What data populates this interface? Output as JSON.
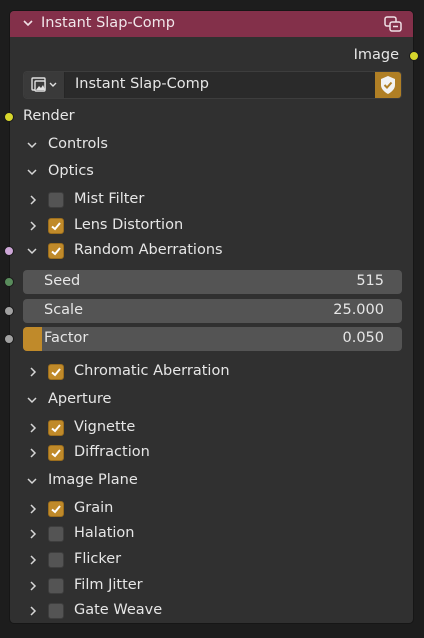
{
  "node": {
    "title": "Instant Slap-Comp",
    "output_label": "Image",
    "datablock_name": "Instant Slap-Comp",
    "render_input_label": "Render",
    "colors": {
      "header": "#83304a",
      "accent": "#c08a2a",
      "socket_color": "#d6d62c",
      "socket_bool": "#cca6d6",
      "socket_int": "#598c5c",
      "socket_float": "#a1a1a1"
    }
  },
  "panels": {
    "controls": "Controls",
    "optics": "Optics",
    "mist_filter": "Mist Filter",
    "lens_distortion": "Lens Distortion",
    "random_aberrations": "Random Aberrations",
    "chromatic_aberration": "Chromatic Aberration",
    "aperture": "Aperture",
    "vignette": "Vignette",
    "diffraction": "Diffraction",
    "image_plane": "Image Plane",
    "grain": "Grain",
    "halation": "Halation",
    "flicker": "Flicker",
    "film_jitter": "Film Jitter",
    "gate_weave": "Gate Weave"
  },
  "checked": {
    "mist_filter": false,
    "lens_distortion": true,
    "random_aberrations": true,
    "chromatic_aberration": true,
    "vignette": true,
    "diffraction": true,
    "grain": true,
    "halation": false,
    "flicker": false,
    "film_jitter": false,
    "gate_weave": false
  },
  "fields": {
    "seed": {
      "label": "Seed",
      "value": "515"
    },
    "scale": {
      "label": "Scale",
      "value": "25.000"
    },
    "factor": {
      "label": "Factor",
      "value": "0.050",
      "fraction": 0.05
    }
  },
  "icons": {
    "header_collapse": "chevron-down-icon",
    "node_group": "node-group-icon",
    "datablock_browse": "image-browse-icon",
    "fake_user": "shield-check-icon"
  }
}
